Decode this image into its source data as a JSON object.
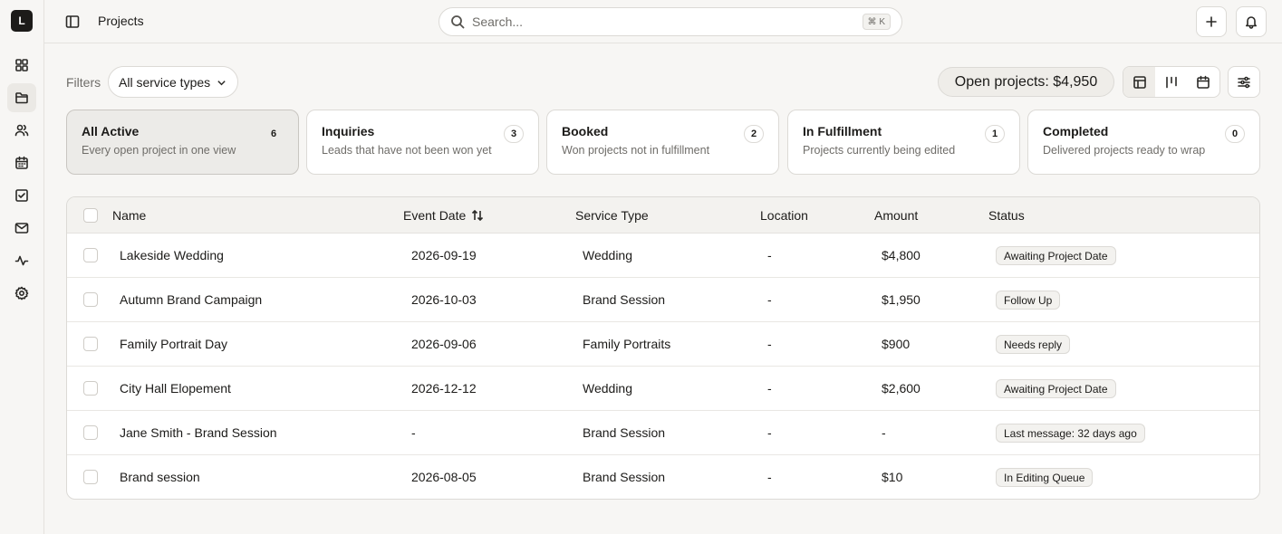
{
  "app": {
    "logo_letter": "L"
  },
  "topbar": {
    "title": "Projects",
    "search_placeholder": "Search...",
    "search_shortcut": "⌘ K"
  },
  "filters": {
    "label": "Filters",
    "service_type_selected": "All service types"
  },
  "summary": {
    "open_projects": "Open projects: $4,950"
  },
  "stages": [
    {
      "title": "All Active",
      "desc": "Every open project in one view",
      "count": "6"
    },
    {
      "title": "Inquiries",
      "desc": "Leads that have not been won yet",
      "count": "3"
    },
    {
      "title": "Booked",
      "desc": "Won projects not in fulfillment",
      "count": "2"
    },
    {
      "title": "In Fulfillment",
      "desc": "Projects currently being edited",
      "count": "1"
    },
    {
      "title": "Completed",
      "desc": "Delivered projects ready to wrap",
      "count": "0"
    }
  ],
  "table": {
    "headers": {
      "name": "Name",
      "event_date": "Event Date",
      "service_type": "Service Type",
      "location": "Location",
      "amount": "Amount",
      "status": "Status"
    },
    "rows": [
      {
        "name": "Lakeside Wedding",
        "date": "2026-09-19",
        "service": "Wedding",
        "location": "-",
        "amount": "$4,800",
        "status": "Awaiting Project Date"
      },
      {
        "name": "Autumn Brand Campaign",
        "date": "2026-10-03",
        "service": "Brand Session",
        "location": "-",
        "amount": "$1,950",
        "status": "Follow Up"
      },
      {
        "name": "Family Portrait Day",
        "date": "2026-09-06",
        "service": "Family Portraits",
        "location": "-",
        "amount": "$900",
        "status": "Needs reply"
      },
      {
        "name": "City Hall Elopement",
        "date": "2026-12-12",
        "service": "Wedding",
        "location": "-",
        "amount": "$2,600",
        "status": "Awaiting Project Date"
      },
      {
        "name": "Jane Smith - Brand Session",
        "date": "-",
        "service": "Brand Session",
        "location": "-",
        "amount": "-",
        "status": "Last message: 32 days ago"
      },
      {
        "name": "Brand session",
        "date": "2026-08-05",
        "service": "Brand Session",
        "location": "-",
        "amount": "$10",
        "status": "In Editing Queue"
      }
    ]
  }
}
